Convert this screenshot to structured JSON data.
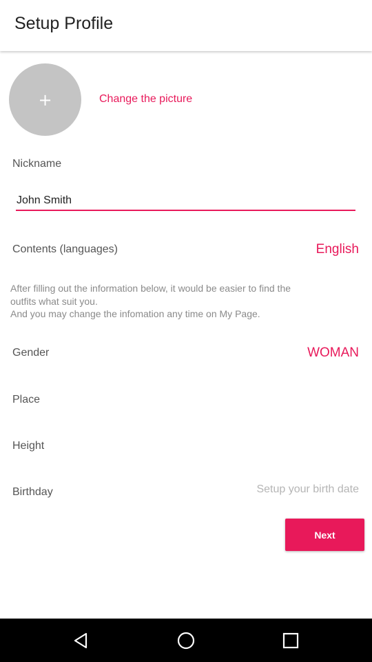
{
  "header": {
    "title": "Setup Profile"
  },
  "avatar": {
    "icon": "plus-icon",
    "glyph": "+"
  },
  "change_picture_label": "Change the picture",
  "nickname": {
    "label": "Nickname",
    "value": "John Smith"
  },
  "contents": {
    "label": "Contents (languages)",
    "value": "English"
  },
  "info_lines": [
    "After filling out the information below, it would be easier to find the",
    "outfits what suit you.",
    "And you may change the infomation any time on My Page."
  ],
  "gender": {
    "label": "Gender",
    "value": "WOMAN"
  },
  "place": {
    "label": "Place"
  },
  "height": {
    "label": "Height"
  },
  "birthday": {
    "label": "Birthday",
    "placeholder": "Setup your birth date"
  },
  "next_label": "Next",
  "colors": {
    "accent": "#e8195a",
    "avatar_bg": "#c4c4c4",
    "navbar": "#000000"
  },
  "navbar": {
    "icons": [
      "back-icon",
      "home-icon",
      "recents-icon"
    ]
  }
}
